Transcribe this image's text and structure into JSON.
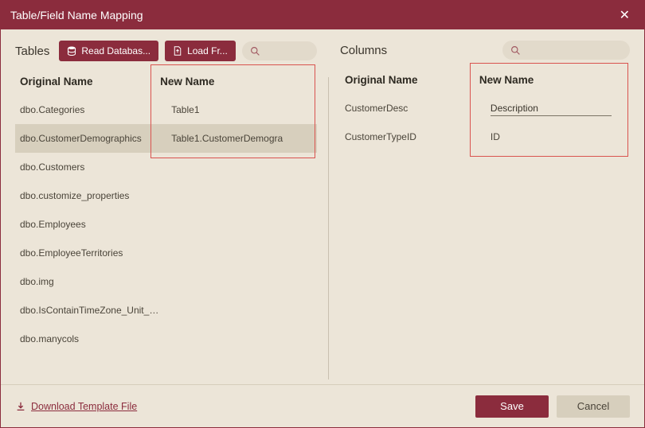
{
  "window": {
    "title": "Table/Field Name Mapping"
  },
  "toolbar": {
    "read_db_label": "Read Databas...",
    "load_label": "Load Fr..."
  },
  "panels": {
    "tables_title": "Tables",
    "columns_title": "Columns",
    "col_original": "Original Name",
    "col_new": "New Name"
  },
  "tables": [
    {
      "orig": "dbo.Categories",
      "newn": "Table1",
      "selected": false
    },
    {
      "orig": "dbo.CustomerDemographics",
      "newn": "Table1.CustomerDemogra",
      "selected": true
    },
    {
      "orig": "dbo.Customers",
      "newn": "",
      "selected": false
    },
    {
      "orig": "dbo.customize_properties",
      "newn": "",
      "selected": false
    },
    {
      "orig": "dbo.Employees",
      "newn": "",
      "selected": false
    },
    {
      "orig": "dbo.EmployeeTerritories",
      "newn": "",
      "selected": false
    },
    {
      "orig": "dbo.img",
      "newn": "",
      "selected": false
    },
    {
      "orig": "dbo.IsContainTimeZone_Unit_Test",
      "newn": "",
      "selected": false
    },
    {
      "orig": "dbo.manycols",
      "newn": "",
      "selected": false
    }
  ],
  "columns": [
    {
      "orig": "CustomerDesc",
      "newn": "Description",
      "editing": true
    },
    {
      "orig": "CustomerTypeID",
      "newn": "ID",
      "editing": false
    }
  ],
  "footer": {
    "download_label": "Download Template File",
    "save_label": "Save",
    "cancel_label": "Cancel"
  }
}
